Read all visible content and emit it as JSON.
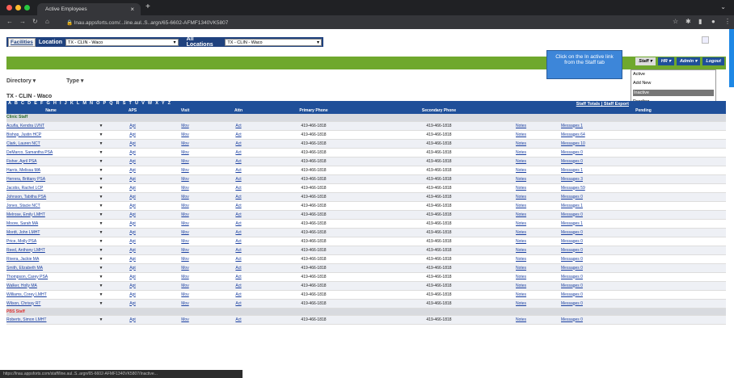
{
  "browser": {
    "tab_title": "Active Employees",
    "address": "lnau.appsforts.com/...line.aul..S..argn/65-6602-AFMF1340VK5807",
    "dots": [
      "#ff5f57",
      "#febc2e",
      "#28c840"
    ]
  },
  "locbar": {
    "facilities": "Facilities",
    "location_label": "Location",
    "location_value": "TX - CLIN - Waco",
    "all_locations": "All Locations",
    "all_value": "TX - CLIN - Waco"
  },
  "toolbar": {
    "staff": "Staff ▾",
    "hr": "HR ▾",
    "admin": "Admin ▾",
    "logout": "Logout"
  },
  "tooltip": "Click on the In active link from the Staff tab",
  "staff_menu": [
    "Active",
    "Add New",
    "Inactive",
    "Pending"
  ],
  "filters": {
    "directory": "Directory ▾",
    "type": "Type ▾"
  },
  "location_title": "TX - CLIN - Waco",
  "alpha": "A B C D E F G H I J K L M N O P Q R S T U V W X Y Z",
  "totals": "Staff Totals | Staff Export",
  "headers": [
    "Name",
    "",
    "APS",
    "Visit",
    "Attn",
    "Primary Phone",
    "Secondary Phone",
    "",
    "Pending"
  ],
  "sections": {
    "clinic": "Clinic Staff",
    "pbs": "PBS Staff"
  },
  "clinic_rows": [
    [
      "Acuña, Kendra LVNT",
      "419-466-1818",
      "Messages 1"
    ],
    [
      "Bishop, Justin HCP",
      "419-466-1818",
      "Messages 64"
    ],
    [
      "Clark, Lauren NCT",
      "419-466-1818",
      "Messages 10"
    ],
    [
      "DeMarco, Samantha PSA",
      "419-466-1818",
      "Messages 0"
    ],
    [
      "Fisher, April PSA",
      "419-466-1818",
      "Messages 0"
    ],
    [
      "Harris, Melissa MA",
      "419-466-1818",
      "Messages 1"
    ],
    [
      "Herrera, Brittany PSA",
      "419-466-1818",
      "Messages 3"
    ],
    [
      "Jacobs, Rachel LCP",
      "419-466-1818",
      "Messages 59"
    ],
    [
      "Johnson, Tabitha PSA",
      "419-466-1818",
      "Messages 0"
    ],
    [
      "Jones, Stacie NCT",
      "419-466-1818",
      "Messages 1"
    ],
    [
      "Melrose, Emily LMHT",
      "419-466-1818",
      "Messages 0"
    ],
    [
      "Moore, Sarah MA",
      "419-466-1818",
      "Messages 1"
    ],
    [
      "Mordt, John LMHT",
      "419-466-1818",
      "Messages 0"
    ],
    [
      "Price, Molly PSA",
      "419-466-1818",
      "Messages 0"
    ],
    [
      "Reed, Anthony LMHT",
      "419-466-1818",
      "Messages 0"
    ],
    [
      "Rivera, Jackie MA",
      "419-466-1818",
      "Messages 0"
    ],
    [
      "Smith, Elizabeth MA",
      "419-466-1818",
      "Messages 0"
    ],
    [
      "Thompson, Carey PSA",
      "419-466-1818",
      "Messages 0"
    ],
    [
      "Walker, Holly MA",
      "419-466-1818",
      "Messages 0"
    ],
    [
      "Williams, Corey LMHT",
      "419-466-1818",
      "Messages 0"
    ],
    [
      "Wilson, Chrissy RT",
      "419-466-1818",
      "Messages 0"
    ]
  ],
  "pbs_rows": [
    [
      "Roberts, Simon LMHT",
      "419-466-1818",
      "Messages 0"
    ]
  ],
  "cells": {
    "aps": "Apt",
    "visit": "Mov",
    "attn": "Act",
    "notes": "Notes"
  },
  "status_url": "https://lnau.appsforts.com/staff/line.aul..S..argn/65-6602-AFMF1340VK5807/Inactive..."
}
